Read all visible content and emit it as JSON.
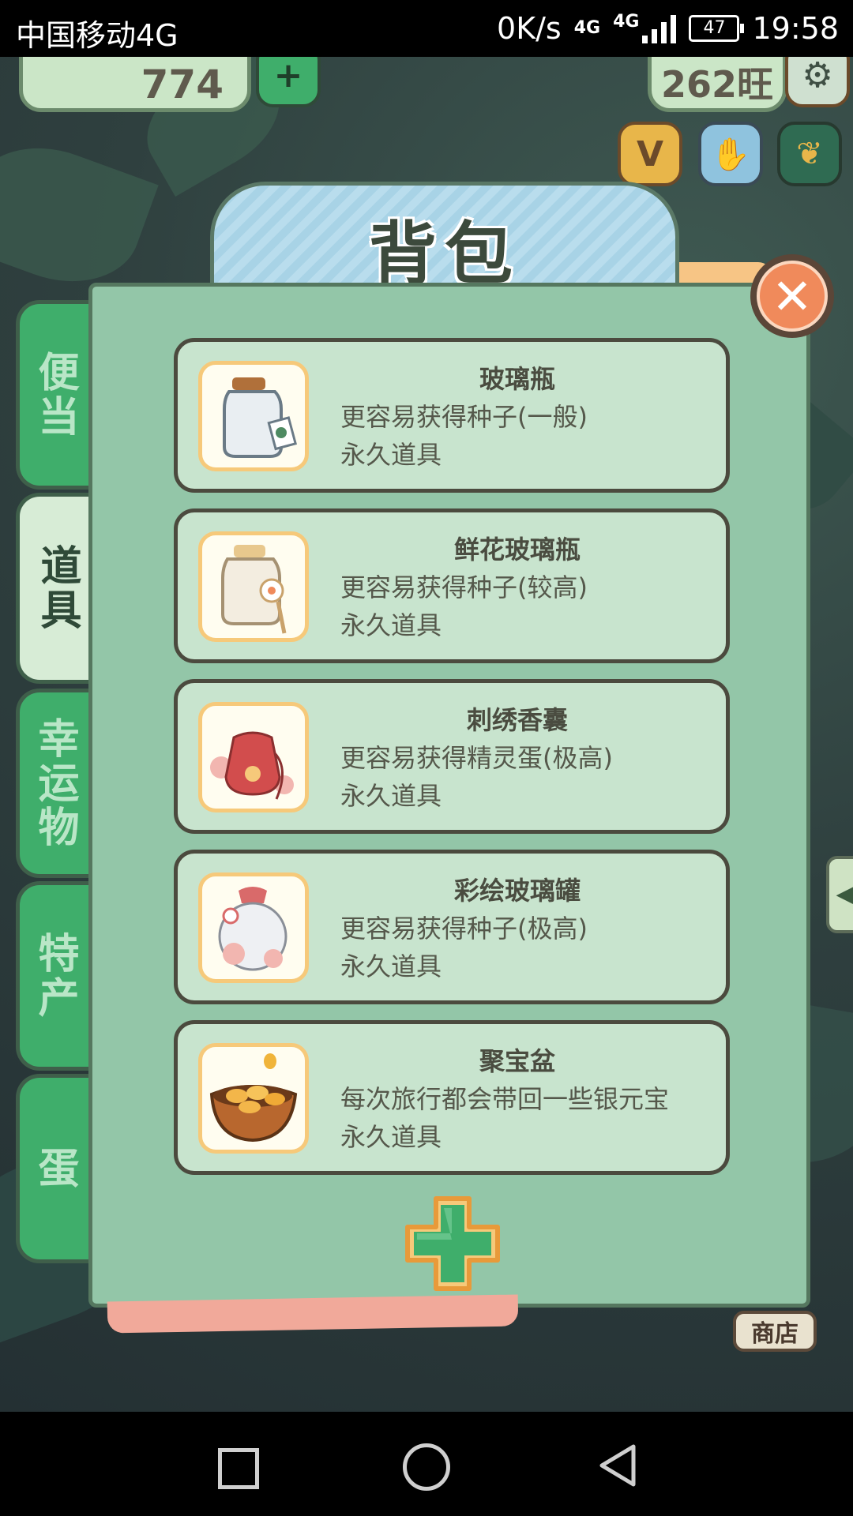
{
  "status_bar": {
    "carrier": "中国移动4G",
    "speed": "0K/s",
    "network": "4G",
    "network_small": "4G",
    "battery": "47",
    "time": "19:58"
  },
  "game_hud": {
    "left_counter": "774",
    "right_counter": "262旺",
    "shop_label": "商店"
  },
  "panel": {
    "title": "背包",
    "tabs": [
      {
        "label": "便当",
        "active": false
      },
      {
        "label": "道具",
        "active": true
      },
      {
        "label": "幸运物",
        "active": false
      },
      {
        "label": "特产",
        "active": false
      },
      {
        "label": "蛋",
        "active": false
      }
    ],
    "items": [
      {
        "name": "玻璃瓶",
        "desc": "更容易获得种子(一般)",
        "kind": "永久道具",
        "icon": "glass-bottle-icon"
      },
      {
        "name": "鲜花玻璃瓶",
        "desc": "更容易获得种子(较高)",
        "kind": "永久道具",
        "icon": "flower-glass-bottle-icon"
      },
      {
        "name": "刺绣香囊",
        "desc": "更容易获得精灵蛋(极高)",
        "kind": "永久道具",
        "icon": "embroidered-sachet-icon"
      },
      {
        "name": "彩绘玻璃罐",
        "desc": "更容易获得种子(极高)",
        "kind": "永久道具",
        "icon": "painted-glass-jar-icon"
      },
      {
        "name": "聚宝盆",
        "desc": "每次旅行都会带回一些银元宝",
        "kind": "永久道具",
        "icon": "treasure-bowl-icon"
      }
    ],
    "close_icon": "close-icon",
    "add_icon": "plus-icon"
  },
  "colors": {
    "panel_bg": "#93c6a8",
    "tab_green": "#3fae6b",
    "item_bg": "#c8e4ce",
    "close_orange": "#f08a5b",
    "plus_green": "#3fae6b"
  }
}
